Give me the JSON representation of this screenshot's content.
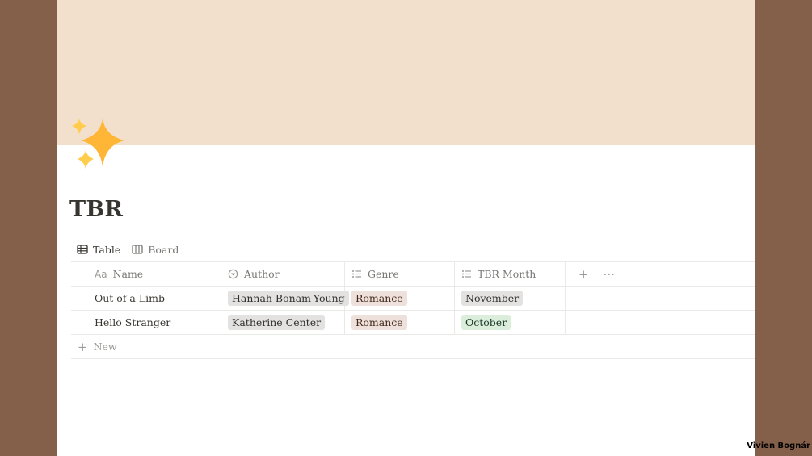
{
  "page": {
    "title": "TBR",
    "icon": "sparkles-icon",
    "colors": {
      "background": "#845F4A",
      "cover": "#F2E0CD",
      "sparkle": "#FFB636"
    }
  },
  "views": [
    {
      "label": "Table",
      "icon": "table-icon",
      "active": true
    },
    {
      "label": "Board",
      "icon": "board-icon",
      "active": false
    }
  ],
  "table": {
    "columns": [
      {
        "label": "Name",
        "icon": "title-aa-icon"
      },
      {
        "label": "Author",
        "icon": "select-icon"
      },
      {
        "label": "Genre",
        "icon": "multi-select-icon"
      },
      {
        "label": "TBR Month",
        "icon": "multi-select-icon"
      }
    ],
    "add_column_icon": "plus-icon",
    "more_icon": "more-icon",
    "rows": [
      {
        "name": "Out of a Limb",
        "author": "Hannah Bonam-Young",
        "genre": "Romance",
        "month": "November",
        "month_color": "gray"
      },
      {
        "name": "Hello Stranger",
        "author": "Katherine Center",
        "genre": "Romance",
        "month": "October",
        "month_color": "green"
      }
    ],
    "new_label": "New"
  },
  "credit": "Vivien Bognár"
}
